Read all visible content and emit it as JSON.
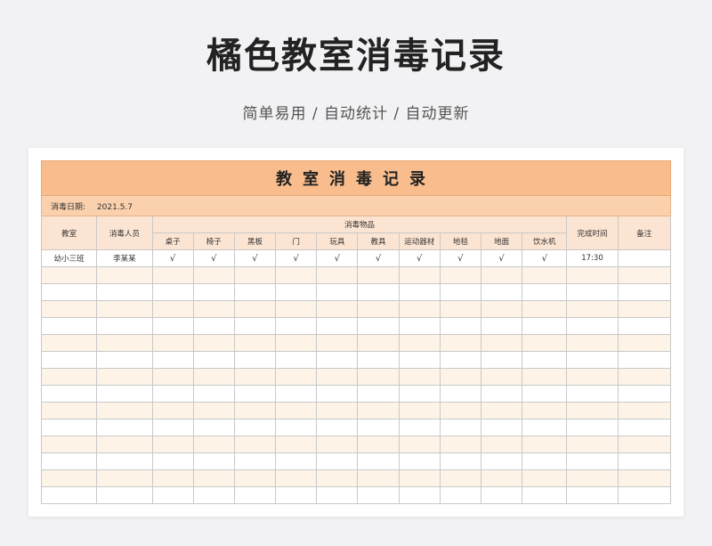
{
  "page": {
    "title": "橘色教室消毒记录",
    "subtitle": "简单易用 / 自动统计 / 自动更新"
  },
  "sheet": {
    "banner": "教室消毒记录",
    "date_label": "消毒日期:",
    "date_value": "2021.5.7",
    "headers": {
      "classroom": "教室",
      "person": "消毒人员",
      "items_group": "消毒物品",
      "completed_time": "完成时间",
      "notes": "备注"
    },
    "items": [
      "桌子",
      "椅子",
      "黑板",
      "门",
      "玩具",
      "教具",
      "运动器材",
      "地毯",
      "地面",
      "饮水机"
    ],
    "rows": [
      {
        "classroom": "幼小三班",
        "person": "李某某",
        "checks": [
          "√",
          "√",
          "√",
          "√",
          "√",
          "√",
          "√",
          "√",
          "√",
          "√"
        ],
        "completed_time": "17:30",
        "notes": ""
      }
    ],
    "empty_row_count": 14
  },
  "colors": {
    "banner": "#f9bd8d",
    "date_row": "#fbd0ad",
    "header": "#fce4d2",
    "alt_row": "#fdf3e6"
  }
}
